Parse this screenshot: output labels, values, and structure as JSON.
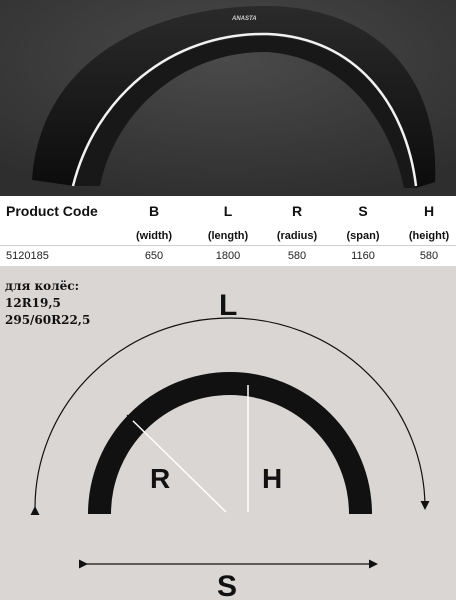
{
  "product_photo": {
    "brand_mark": "ANASTA"
  },
  "table": {
    "code_header": "Product Code",
    "columns": [
      {
        "letter": "B",
        "desc": "(width)"
      },
      {
        "letter": "L",
        "desc": "(length)"
      },
      {
        "letter": "R",
        "desc": "(radius)"
      },
      {
        "letter": "S",
        "desc": "(span)"
      },
      {
        "letter": "H",
        "desc": "(height)"
      }
    ],
    "row": {
      "code": "5120185",
      "values": [
        "650",
        "1800",
        "580",
        "1160",
        "580"
      ]
    }
  },
  "wheel_note": {
    "title": "для колёс:",
    "sizes": [
      "12R19,5",
      "295/60R22,5"
    ]
  },
  "diagram_labels": {
    "length": "L",
    "radius": "R",
    "height": "H",
    "span": "S"
  }
}
